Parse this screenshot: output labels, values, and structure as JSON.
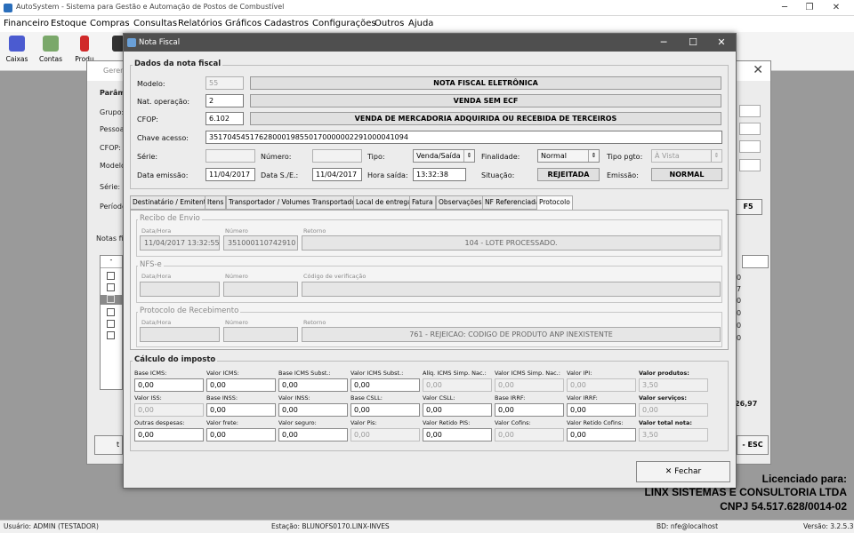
{
  "app": {
    "title": "AutoSystem - Sistema para Gestão e Automação de Postos de Combustível",
    "menu": [
      "Financeiro",
      "Estoque",
      "Compras",
      "Consultas",
      "Relatórios",
      "Gráficos",
      "Cadastros",
      "Configurações",
      "Outros",
      "Ajuda"
    ],
    "toolbar": [
      "Caixas",
      "Contas",
      "Produ"
    ]
  },
  "background_window": {
    "title": "Gerenc",
    "section": "Parâme",
    "labels": [
      "Grupo:",
      "Pessoa:",
      "CFOP:",
      "Modelo:",
      "Série:",
      "Período"
    ],
    "notas_label": "Notas fis",
    "checkbox_header": "-",
    "button_f5": "F5",
    "right_values": [
      "0",
      "7",
      "0",
      "0",
      "0",
      "0"
    ],
    "total": "26,97",
    "button_esc": "- ESC",
    "bottom_button": "t"
  },
  "dialog": {
    "title": "Nota Fiscal",
    "dados": {
      "title": "Dados da nota fiscal",
      "modelo_label": "Modelo:",
      "modelo": "55",
      "modelo_desc": "NOTA FISCAL ELETRÔNICA",
      "natop_label": "Nat. operação:",
      "natop": "2",
      "natop_desc": "VENDA SEM ECF",
      "cfop_label": "CFOP:",
      "cfop": "6.102",
      "cfop_desc": "VENDA DE MERCADORIA ADQUIRIDA OU RECEBIDA DE TERCEIROS",
      "chave_label": "Chave acesso:",
      "chave": "35170454517628000198550170000002291000041094",
      "serie_label": "Série:",
      "serie": "",
      "numero_label": "Número:",
      "numero": "",
      "tipo_label": "Tipo:",
      "tipo": "Venda/Saída",
      "finalidade_label": "Finalidade:",
      "finalidade": "Normal",
      "tipopgto_label": "Tipo pgto:",
      "tipopgto": "À Vista",
      "emissao_label": "Data emissão:",
      "emissao": "11/04/2017",
      "dataes_label": "Data S./E.:",
      "dataes": "11/04/2017",
      "horasaida_label": "Hora saída:",
      "horasaida": "13:32:38",
      "situacao_label": "Situação:",
      "situacao": "REJEITADA",
      "emissao_tipo_label": "Emissão:",
      "emissao_tipo": "NORMAL"
    },
    "tabs": [
      "Destinatário / Emitente",
      "Itens",
      "Transportador / Volumes Transportados",
      "Local de entrega",
      "Fatura",
      "Observações",
      "NF Referenciada",
      "Protocolo"
    ],
    "active_tab": "Protocolo",
    "protocolo": {
      "recibo_title": "Recibo de Envio",
      "recibo_datahora_label": "Data/Hora",
      "recibo_datahora": "11/04/2017 13:32:55",
      "recibo_numero_label": "Número",
      "recibo_numero": "351000110742910",
      "recibo_retorno_label": "Retorno",
      "recibo_retorno": "104 - LOTE PROCESSADO.",
      "nfse_title": "NFS-e",
      "nfse_datahora_label": "Data/Hora",
      "nfse_numero_label": "Número",
      "nfse_codigo_label": "Código de verificação",
      "prot_title": "Protocolo de Recebimento",
      "prot_datahora_label": "Data/Hora",
      "prot_numero_label": "Número",
      "prot_retorno_label": "Retorno",
      "prot_retorno": "761 - REJEICAO: CODIGO DE PRODUTO ANP INEXISTENTE"
    },
    "imposto": {
      "title": "Cálculo do imposto",
      "rows": [
        [
          {
            "label": "Base ICMS:",
            "value": "0,00",
            "disabled": false,
            "bold": false
          },
          {
            "label": "Valor ICMS:",
            "value": "0,00",
            "disabled": false,
            "bold": false
          },
          {
            "label": "Base ICMS Subst.:",
            "value": "0,00",
            "disabled": false,
            "bold": false
          },
          {
            "label": "Valor ICMS Subst.:",
            "value": "0,00",
            "disabled": false,
            "bold": false
          },
          {
            "label": "Alíq. ICMS Simp. Nac.:",
            "value": "0,00",
            "disabled": true,
            "bold": false
          },
          {
            "label": "Valor ICMS Simp. Nac.:",
            "value": "0,00",
            "disabled": true,
            "bold": false
          },
          {
            "label": "Valor IPI:",
            "value": "0,00",
            "disabled": true,
            "bold": false
          },
          {
            "label": "Valor produtos:",
            "value": "3,50",
            "disabled": true,
            "bold": true
          }
        ],
        [
          {
            "label": "Valor ISS:",
            "value": "0,00",
            "disabled": true,
            "bold": false
          },
          {
            "label": "Base INSS:",
            "value": "0,00",
            "disabled": false,
            "bold": false
          },
          {
            "label": "Valor INSS:",
            "value": "0,00",
            "disabled": false,
            "bold": false
          },
          {
            "label": "Base CSLL:",
            "value": "0,00",
            "disabled": false,
            "bold": false
          },
          {
            "label": "Valor CSLL:",
            "value": "0,00",
            "disabled": false,
            "bold": false
          },
          {
            "label": "Base IRRF:",
            "value": "0,00",
            "disabled": false,
            "bold": false
          },
          {
            "label": "Valor IRRF:",
            "value": "0,00",
            "disabled": false,
            "bold": false
          },
          {
            "label": "Valor serviços:",
            "value": "0,00",
            "disabled": true,
            "bold": true
          }
        ],
        [
          {
            "label": "Outras despesas:",
            "value": "0,00",
            "disabled": false,
            "bold": false
          },
          {
            "label": "Valor frete:",
            "value": "0,00",
            "disabled": false,
            "bold": false
          },
          {
            "label": "Valor seguro:",
            "value": "0,00",
            "disabled": false,
            "bold": false
          },
          {
            "label": "Valor Pis:",
            "value": "0,00",
            "disabled": true,
            "bold": false
          },
          {
            "label": "Valor Retido PIS:",
            "value": "0,00",
            "disabled": false,
            "bold": false
          },
          {
            "label": "Valor Cofins:",
            "value": "0,00",
            "disabled": true,
            "bold": false
          },
          {
            "label": "Valor Retido Cofins:",
            "value": "0,00",
            "disabled": false,
            "bold": false
          },
          {
            "label": "Valor total nota:",
            "value": "3,50",
            "disabled": true,
            "bold": true
          }
        ]
      ]
    },
    "fechar_label": "Fechar"
  },
  "license": {
    "line1": "Licenciado para:",
    "line2": "LINX SISTEMAS E CONSULTORIA LTDA",
    "line3": "CNPJ 54.517.628/0014-02"
  },
  "status": {
    "usuario": "Usuário: ADMIN (TESTADOR)",
    "estacao": "Estação: BLUNOFS0170.LINX-INVES",
    "bd": "BD: nfe@localhost",
    "versao": "Versão: 3.2.5.3"
  },
  "colors": {
    "dialog_title_bg": "#4f4f4f",
    "window_bg": "#ececec",
    "desktop_bg": "#9a9a9a"
  }
}
